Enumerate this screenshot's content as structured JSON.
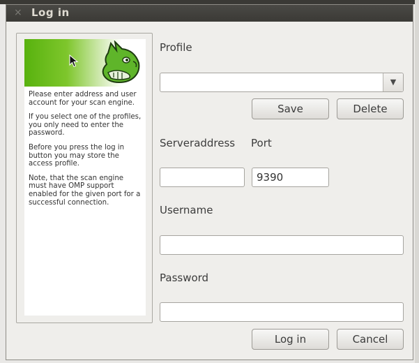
{
  "window": {
    "title": "Log in"
  },
  "help_panel": {
    "paragraphs": [
      "Please enter address and user account for your scan engine.",
      "If you select one of the profiles, you only need to enter the password.",
      "Before you press the log in button you may store the access profile.",
      "Note, that the scan engine must have OMP support enabled for the given port for a successful connection."
    ]
  },
  "form": {
    "profile_label": "Profile",
    "profile_value": "",
    "save_label": "Save",
    "delete_label": "Delete",
    "serveraddress_label": "Serveraddress",
    "port_label": "Port",
    "serveraddress_value": "",
    "port_value": "9390",
    "username_label": "Username",
    "username_value": "",
    "password_label": "Password",
    "password_value": ""
  },
  "actions": {
    "login_label": "Log in",
    "cancel_label": "Cancel"
  },
  "icons": {
    "close": "close-icon",
    "dropdown": "dropdown-arrow-icon",
    "logo": "greenbone-dog-logo",
    "cursor": "mouse-pointer-icon"
  },
  "colors": {
    "titlebar": "#3b3a36",
    "banner_green": "#58b20e",
    "window_bg": "#efeeeb"
  }
}
